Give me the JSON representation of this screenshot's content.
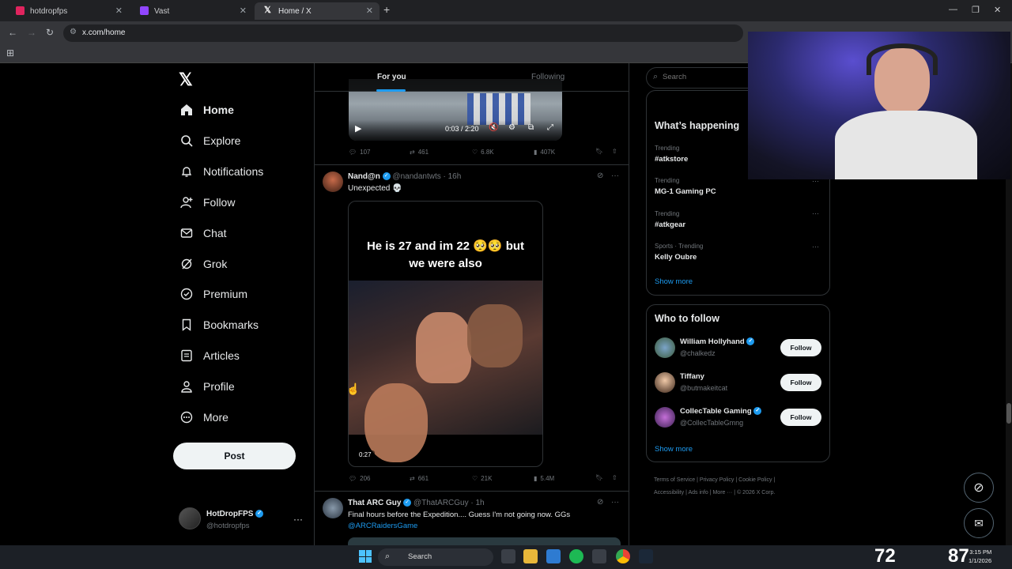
{
  "browser": {
    "tabs": [
      {
        "title": "hotdropfps",
        "active": false,
        "favicon_color": "#e0245e"
      },
      {
        "title": "Vast",
        "active": false,
        "favicon_color": "#9146ff"
      },
      {
        "title": "Home / X",
        "active": true,
        "favicon_color": "#ffffff"
      }
    ],
    "url": "x.com/home"
  },
  "x_logo": "X",
  "sidebar": {
    "items": [
      {
        "label": "Home",
        "icon": "home-icon"
      },
      {
        "label": "Explore",
        "icon": "search-icon"
      },
      {
        "label": "Notifications",
        "icon": "bell-icon"
      },
      {
        "label": "Follow",
        "icon": "add-person-icon"
      },
      {
        "label": "Chat",
        "icon": "mail-icon"
      },
      {
        "label": "Grok",
        "icon": "grok-icon"
      },
      {
        "label": "Premium",
        "icon": "badge-icon"
      },
      {
        "label": "Bookmarks",
        "icon": "bookmark-icon"
      },
      {
        "label": "Articles",
        "icon": "article-icon"
      },
      {
        "label": "Profile",
        "icon": "person-icon"
      },
      {
        "label": "More",
        "icon": "more-circle-icon"
      }
    ],
    "post_label": "Post",
    "account": {
      "name": "HotDropFPS",
      "handle": "@hotdropfps",
      "more": "···"
    }
  },
  "feed": {
    "tabs": [
      "For you",
      "Following"
    ],
    "video1": {
      "time": "0:03 / 2:20"
    },
    "post0_stats": {
      "replies": "107",
      "reposts": "461",
      "likes": "6.8K",
      "views": "407K"
    },
    "post1": {
      "name": "Nand@n",
      "handle": "@nandantwts",
      "age": "· 16h",
      "text": "Unexpected 💀",
      "caption": "He is 27 and im 22 🥺🥺 but we were also",
      "duration": "0:27",
      "stats": {
        "replies": "206",
        "reposts": "661",
        "likes": "21K",
        "views": "5.4M"
      }
    },
    "post2": {
      "name": "That ARC Guy",
      "handle": "@ThatARCGuy",
      "age": "· 1h",
      "text": "Final hours before the Expedition.... Guess I'm not going now. GGs",
      "mention": "@ARCRaidersGame"
    }
  },
  "right": {
    "search_placeholder": "Search",
    "happening": {
      "title": "What’s happening",
      "trends": [
        {
          "meta": "Trending",
          "name": "#atkstore"
        },
        {
          "meta": "Trending",
          "name": "MG-1 Gaming PC"
        },
        {
          "meta": "Trending",
          "name": "#atkgear"
        },
        {
          "meta": "Sports · Trending",
          "name": "Kelly Oubre"
        }
      ],
      "show_more": "Show more"
    },
    "who_to_follow": {
      "title": "Who to follow",
      "people": [
        {
          "name": "William Hollyhand",
          "handle": "@chalkedz",
          "verified": true,
          "button": "Follow"
        },
        {
          "name": "Tiffany",
          "handle": "@butmakeitcat",
          "verified": false,
          "button": "Follow"
        },
        {
          "name": "CollecTable Gaming",
          "handle": "@CollecTableGmng",
          "verified": true,
          "button": "Follow"
        }
      ],
      "show_more": "Show more"
    },
    "footer": [
      "Terms of Service",
      "Privacy Policy",
      "Cookie Policy",
      "Accessibility",
      "Ads info",
      "More ···",
      "© 2026 X Corp."
    ]
  },
  "overlay": {
    "counter_left": "72",
    "counter_right": "87"
  },
  "taskbar": {
    "search": "Search",
    "time": "3:15 PM",
    "date": "1/1/2026"
  }
}
